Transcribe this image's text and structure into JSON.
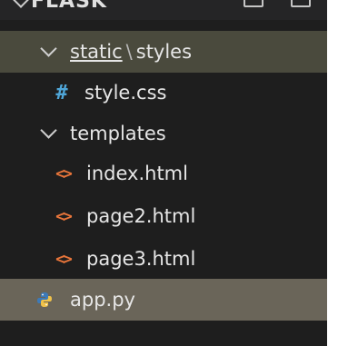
{
  "explorer": {
    "root_label": "FLASK",
    "rows": [
      {
        "folder": "static",
        "separator": "\\",
        "subfolder": "styles"
      },
      {
        "label": "style.css",
        "icon": "css-hash-icon"
      },
      {
        "label": "templates"
      },
      {
        "label": "index.html",
        "icon": "html-icon"
      },
      {
        "label": "page2.html",
        "icon": "html-icon"
      },
      {
        "label": "page3.html",
        "icon": "html-icon"
      },
      {
        "label": "app.py",
        "icon": "python-icon"
      }
    ]
  },
  "colors": {
    "background": "#1e1e1e",
    "selected_row": "#4a4a3d",
    "active_row": "#6a6559",
    "css_icon": "#4fa6d8",
    "html_icon": "#e8753a",
    "python_icon_blue": "#3d7ab8",
    "python_icon_yellow": "#f0c24a"
  }
}
